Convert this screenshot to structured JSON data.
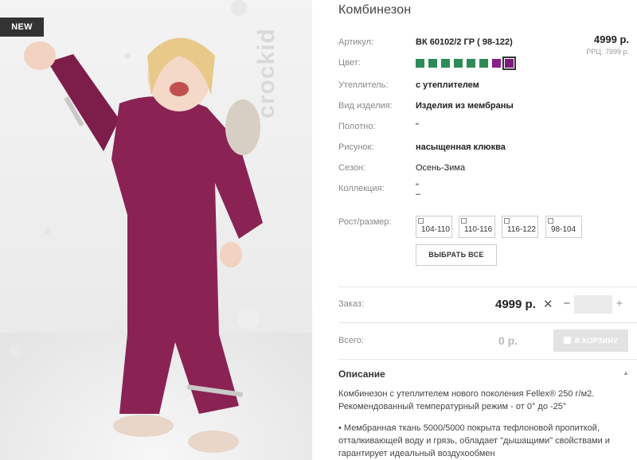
{
  "photo": {
    "badge": "NEW",
    "brand": "crockid"
  },
  "product": {
    "title": "Комбинезон",
    "price": "4999 р.",
    "rrc": "РРЦ: 7999 р.",
    "specs": [
      {
        "label": "Артикул:",
        "value": "ВК 60102/2 ГР ( 98-122)"
      },
      {
        "label": "Цвет:",
        "value": ""
      },
      {
        "label": "Утеплитель:",
        "value": "с утеплителем"
      },
      {
        "label": "Вид изделия:",
        "value": "Изделия из мембраны"
      },
      {
        "label": "Полотно:",
        "value": "\""
      },
      {
        "label": "Рисунок:",
        "value": "насыщенная клюква"
      },
      {
        "label": "Сезон:",
        "value": "Осень-Зима"
      },
      {
        "label": "Коллекция:",
        "value": "\"\n–"
      }
    ],
    "colors": [
      "#2e8b57",
      "#2e8b57",
      "#2e8b57",
      "#2e8b57",
      "#2e8b57",
      "#2e8b57",
      "#8a1f8f",
      "#7a1a7e"
    ],
    "sizes_label": "Рост/размер:",
    "sizes": [
      "104-110",
      "110-116",
      "116-122",
      "98-104"
    ],
    "select_all": "ВЫБРАТЬ ВСЕ"
  },
  "order": {
    "label": "Заказ:",
    "price": "4999 р.",
    "times": "✕",
    "minus": "−",
    "plus": "+",
    "qty": ""
  },
  "total": {
    "label": "Всего:",
    "value": "0 р.",
    "cart_button": "В КОРЗИНУ"
  },
  "description": {
    "heading": "Описание",
    "toggle_icon": "▲",
    "p1": "Комбинезон с утеплителем нового поколения Fellex® 250 г/м2. Рекомендованный температурный режим - от 0° до -25°",
    "p2": "• Мембранная ткань 5000/5000 покрыта тефлоновой пропиткой, отталкивающей воду и грязь, обладает \"дышащими\" свойствами и гарантирует идеальный воздухообмен"
  }
}
